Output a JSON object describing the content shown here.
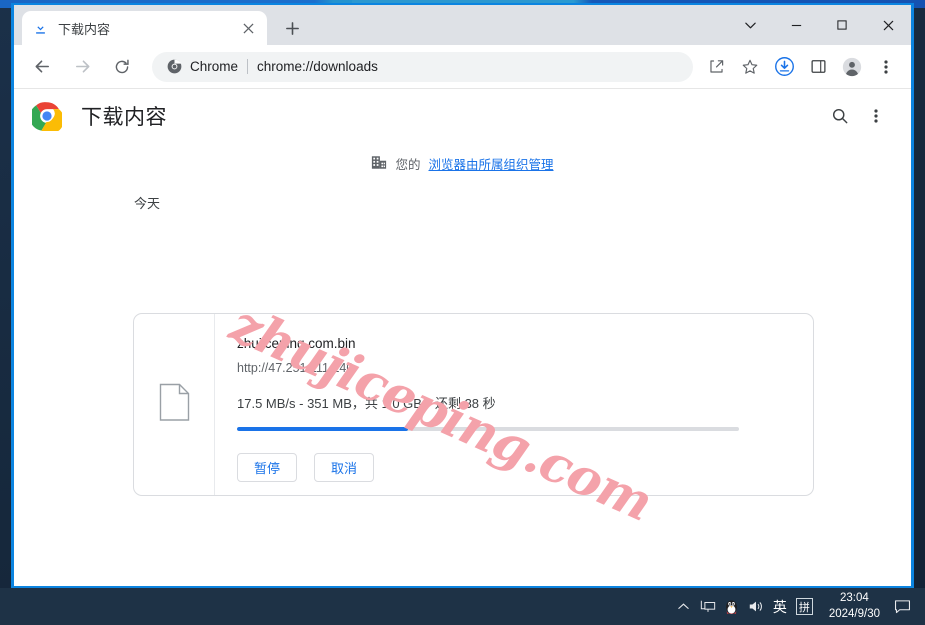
{
  "window": {
    "tab": {
      "title": "下载内容",
      "favicon_icon": "download-icon",
      "close_icon": "close-icon"
    },
    "new_tab_icon": "plus-icon",
    "controls": {
      "tab_search_icon": "chevron-down-icon",
      "minimize_icon": "minimize-icon",
      "maximize_icon": "maximize-icon",
      "close_icon": "close-icon"
    }
  },
  "toolbar": {
    "back_icon": "arrow-left-icon",
    "forward_icon": "arrow-right-icon",
    "reload_icon": "reload-icon",
    "omnibox": {
      "security_icon": "chrome-logo-icon",
      "chip_label": "Chrome",
      "url": "chrome://downloads"
    },
    "share_icon": "share-icon",
    "bookmark_icon": "star-icon",
    "downloads_icon": "download-circle-icon",
    "side_panel_icon": "side-panel-icon",
    "profile_icon": "avatar-icon",
    "menu_icon": "three-dot-menu-icon"
  },
  "page": {
    "logo_icon": "chrome-logo-icon",
    "title": "下载内容",
    "search_icon": "search-icon",
    "menu_icon": "three-dot-menu-icon",
    "managed_banner": {
      "icon": "enterprise-building-icon",
      "prefix": "您的",
      "link": "浏览器由所属组织管理"
    },
    "today_label": "今天"
  },
  "download": {
    "file_icon": "file-document-icon",
    "filename": "zhujiceping.com.bin",
    "url": "http://47.251.111.140",
    "status": "17.5 MB/s - 351 MB，共 1.0 GB，还剩 38 秒",
    "progress_percent": 34,
    "pause_label": "暂停",
    "cancel_label": "取消"
  },
  "watermark": {
    "text": "zhujiceping.com",
    "color": "#f4a2aa"
  },
  "taskbar": {
    "overflow_icon": "chevron-up-icon",
    "network_icon": "network-icon",
    "qq_icon": "qq-penguin-icon",
    "volume_icon": "speaker-icon",
    "ime_lang": "英",
    "ime_mode": "拼",
    "time": "23:04",
    "date": "2024/9/30",
    "notification_icon": "notification-icon"
  },
  "colors": {
    "accent_blue": "#1a73e8",
    "window_border": "#0b84e0",
    "tabstrip_bg": "#dee1e6",
    "taskbar_bg": "#1e3246"
  }
}
